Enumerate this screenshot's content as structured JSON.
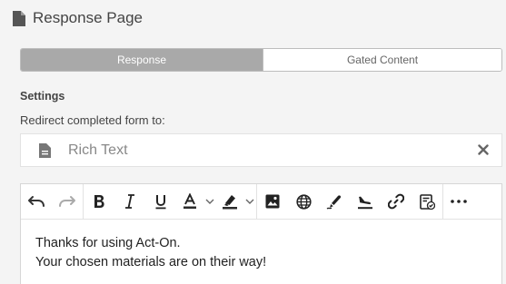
{
  "panel": {
    "title": "Response Page",
    "icon": "document-icon"
  },
  "tabs": [
    {
      "label": "Response",
      "active": true
    },
    {
      "label": "Gated Content",
      "active": false
    }
  ],
  "settings": {
    "heading": "Settings",
    "redirect_label": "Redirect completed form to:",
    "redirect_value": "Rich Text",
    "redirect_icon": "document-icon"
  },
  "toolbar": {
    "groups": [
      [
        "undo-icon",
        "redo-icon"
      ],
      [
        "bold-icon",
        "italic-icon",
        "underline-icon",
        "text-color-icon",
        "highlight-icon"
      ],
      [
        "image-icon",
        "link-globe-icon",
        "signature-icon",
        "landing-icon",
        "link-icon",
        "form-icon"
      ],
      [
        "more-icon"
      ]
    ],
    "accent": "#2b2b2b"
  },
  "editor": {
    "lines": [
      "Thanks for using Act-On.",
      "Your chosen materials are on their way!"
    ]
  }
}
